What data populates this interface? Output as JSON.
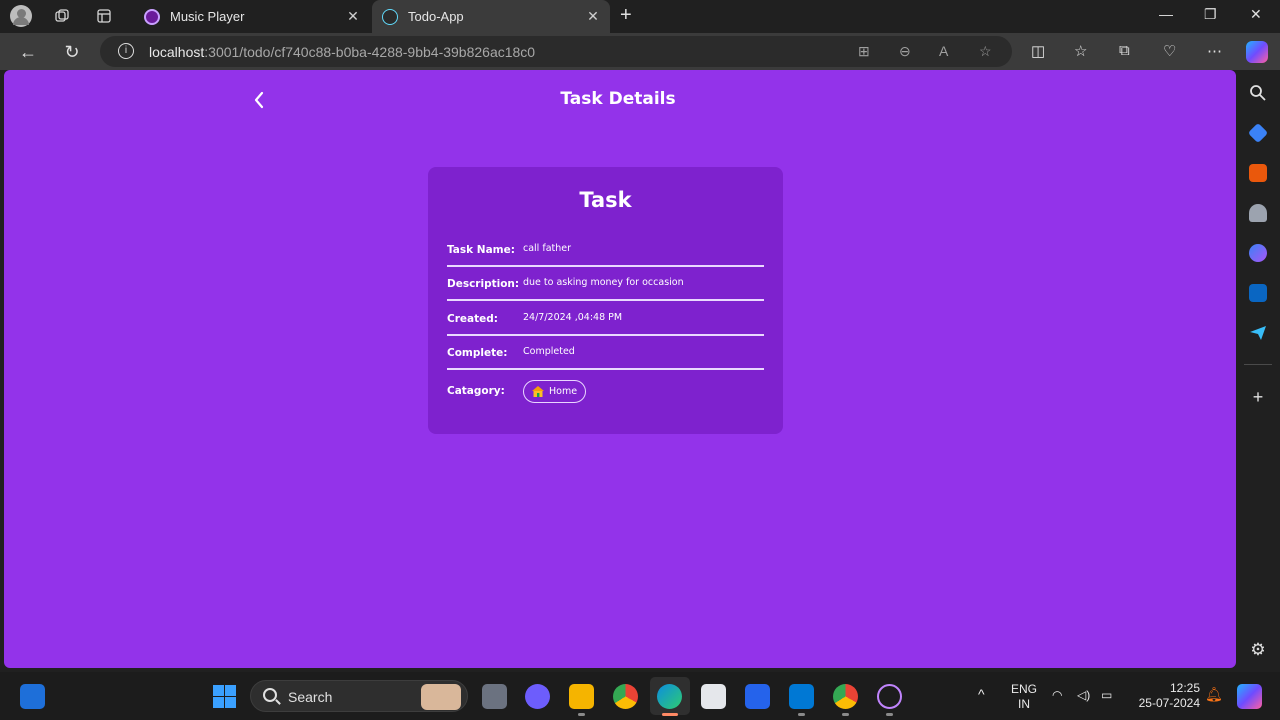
{
  "browser": {
    "tabs": [
      {
        "label": "Music Player",
        "active": false
      },
      {
        "label": "Todo-App",
        "active": true
      }
    ],
    "url_host": "localhost",
    "url_path": ":3001/todo/cf740c88-b0ba-4288-9bb4-39b826ac18c0"
  },
  "page": {
    "title": "Task Details",
    "background": "#9333ea",
    "card": {
      "title": "Task",
      "background": "#7e22ce",
      "fields": [
        {
          "label": "Task Name:",
          "value": "call father"
        },
        {
          "label": "Description:",
          "value": "due to asking money for occasion"
        },
        {
          "label": "Created:",
          "value": "24/7/2024 ,04:48 PM"
        },
        {
          "label": "Complete:",
          "value": "Completed"
        }
      ],
      "category": {
        "label": "Catagory:",
        "value": "Home",
        "icon": "house-icon"
      }
    }
  },
  "taskbar": {
    "search_label": "Search",
    "language_line1": "ENG",
    "language_line2": "IN",
    "time": "12:25",
    "date": "25-07-2024"
  }
}
